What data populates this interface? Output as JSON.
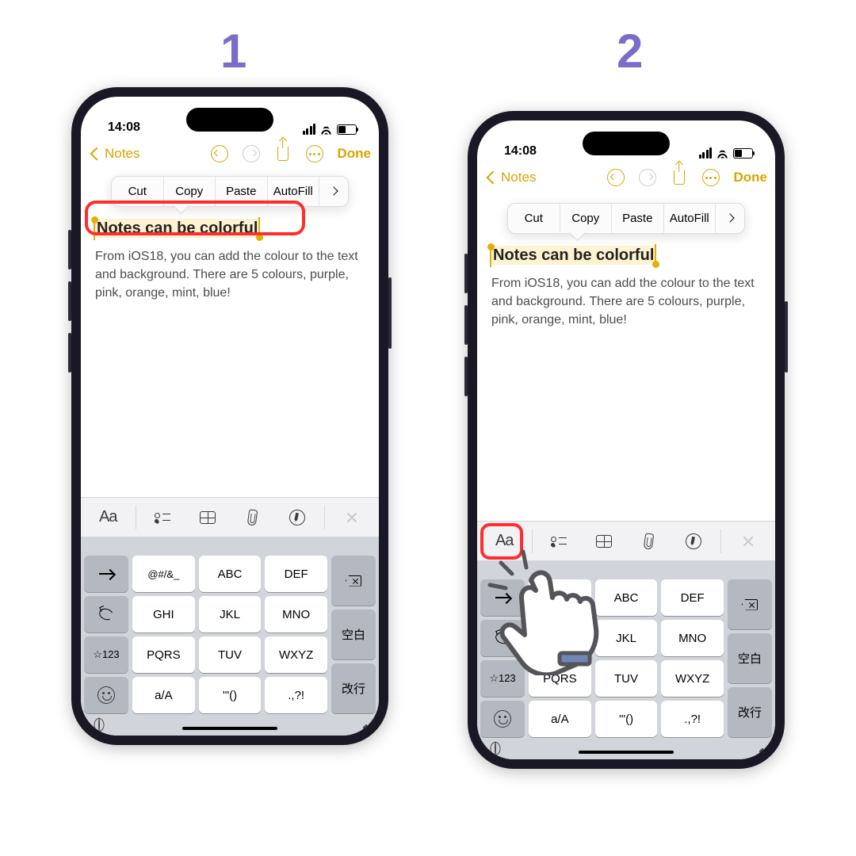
{
  "steps": [
    "1",
    "2"
  ],
  "status": {
    "time": "14:08"
  },
  "nav": {
    "back": "Notes",
    "done": "Done"
  },
  "editMenu": {
    "cut": "Cut",
    "copy": "Copy",
    "paste": "Paste",
    "autofill": "AutoFill"
  },
  "note": {
    "title": "Notes can be colorful",
    "body": "From iOS18, you can add the colour to the text and background. There are 5 colours, purple, pink, orange, mint, blue!"
  },
  "formatBar": {
    "aa": "Aa"
  },
  "keyboard": {
    "star123": "☆123",
    "row1": [
      "@#/&_",
      "ABC",
      "DEF"
    ],
    "row2": [
      "GHI",
      "JKL",
      "MNO"
    ],
    "row3": [
      "PQRS",
      "TUV",
      "WXYZ"
    ],
    "row4": [
      "a/A",
      "'\"()",
      ".,?!"
    ],
    "space": "空白",
    "return": "改行"
  },
  "colors": {
    "accent": "#d9a400",
    "stepNum": "#7b6cc9",
    "highlight": "#ff2d2d"
  }
}
